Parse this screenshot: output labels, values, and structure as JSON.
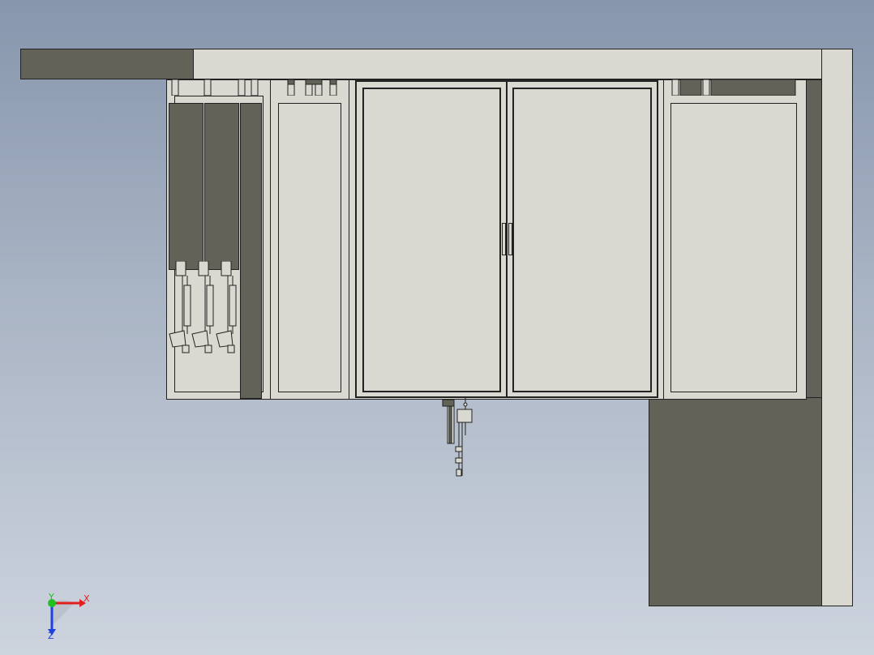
{
  "viewport": {
    "name": "cad-3d-view",
    "background": [
      "#8796ad",
      "#cdd4de"
    ],
    "colors": {
      "panel": "#d9d8d1",
      "dark_panel": "#626258",
      "edge": "#222222"
    }
  },
  "triad": {
    "x_label": "X",
    "y_label": "Y",
    "z_label": "Z",
    "x_color": "#e02020",
    "y_color": "#20c020",
    "z_color": "#2040e0"
  }
}
